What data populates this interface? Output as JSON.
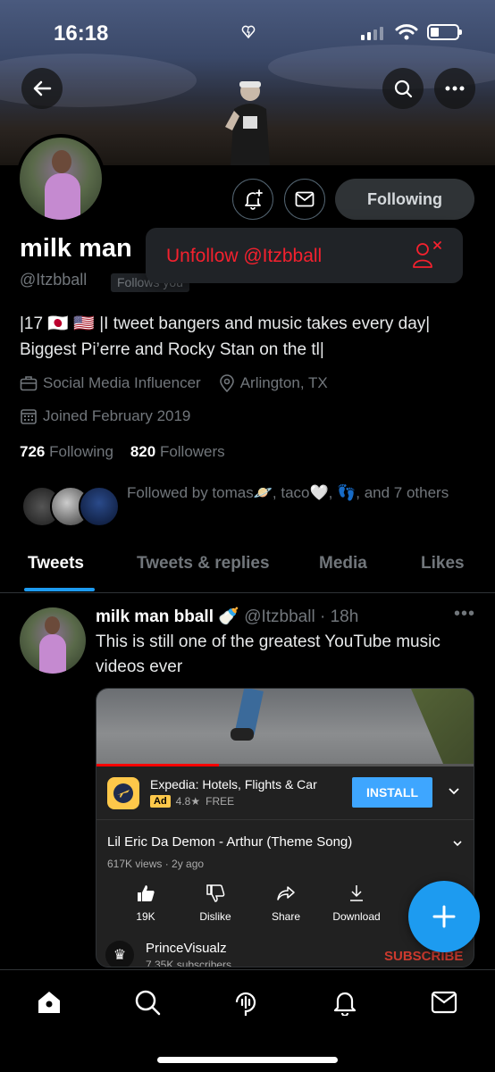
{
  "status_bar": {
    "time": "16:18"
  },
  "profile": {
    "name": "milk man",
    "handle": "@Itzbball",
    "follows_you": "Follows you",
    "following_button": "Following",
    "bio_line1": "|17 🇯🇵 🇺🇸 |I tweet bangers and music takes every day|",
    "bio_line2": "Biggest Pi’erre and Rocky Stan on the tl|",
    "category": "Social Media Influencer",
    "location": "Arlington, TX",
    "joined": "Joined February 2019",
    "following_count": "726",
    "following_label": "Following",
    "followers_count": "820",
    "followers_label": "Followers",
    "followed_by": "Followed by tomas🪐, taco🤍, 👣, and 7 others"
  },
  "popup": {
    "unfollow_label": "Unfollow @Itzbball"
  },
  "tabs": [
    {
      "label": "Tweets"
    },
    {
      "label": "Tweets & replies"
    },
    {
      "label": "Media"
    },
    {
      "label": "Likes"
    }
  ],
  "tweet": {
    "name": "milk man bball 🍼",
    "meta": "@Itzbball · 18h",
    "text": "This is still one of the greatest YouTube music videos ever",
    "embed": {
      "ad_title": "Expedia: Hotels, Flights & Car",
      "ad_badge": "Ad",
      "ad_rating": "4.8★",
      "ad_price": "FREE",
      "install_label": "INSTALL",
      "video_title": "Lil Eric Da Demon - Arthur (Theme Song)",
      "views": "617K views · 2y ago",
      "actions": [
        {
          "label": "19K",
          "icon": "thumbs-up-icon"
        },
        {
          "label": "Dislike",
          "icon": "thumbs-down-icon"
        },
        {
          "label": "Share",
          "icon": "share-icon"
        },
        {
          "label": "Download",
          "icon": "download-icon"
        }
      ],
      "channel_name": "PrinceVisualz",
      "channel_subs": "7.35K subscribers",
      "subscribe_label": "SUBSCRIBE"
    }
  },
  "colors": {
    "accent": "#1d9bf0",
    "danger": "#f4212e",
    "background": "#000000"
  }
}
